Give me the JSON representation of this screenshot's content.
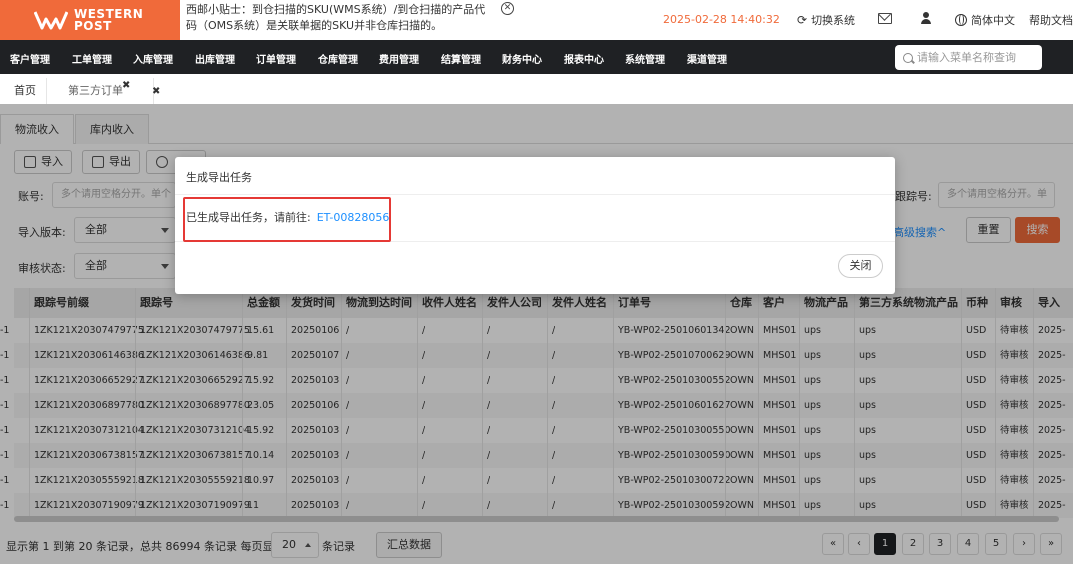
{
  "brand": {
    "name_line1": "WESTERN",
    "name_line2": "POST",
    "color": "#f06a3a"
  },
  "header": {
    "tip": "西邮小贴士：到仓扫描的SKU(WMS系统）/到仓扫描的产品代码（OMS系统）是关联单据的SKU并非仓库扫描的。",
    "datetime": "2025-02-28 14:40:32",
    "switch_system": "切换系统",
    "language": "简体中文",
    "help": "帮助文档"
  },
  "nav": {
    "items": [
      "客户管理",
      "工单管理",
      "入库管理",
      "出库管理",
      "订单管理",
      "仓库管理",
      "费用管理",
      "结算管理",
      "财务中心",
      "报表中心",
      "系统管理",
      "渠道管理"
    ],
    "search_placeholder": "请输入菜单名称查询"
  },
  "page_tabs": {
    "home": "首页",
    "current": "第三方订单"
  },
  "sub_tabs": [
    "物流收入",
    "库内收入"
  ],
  "toolbar": {
    "import": "导入",
    "export": "导出"
  },
  "filters": {
    "account_label": "账号:",
    "account_placeholder": "多个请用空格分开。单个",
    "tracking_label": "跟踪号:",
    "tracking_placeholder": "多个请用空格分开。单",
    "import_version_label": "导入版本:",
    "import_version_value": "全部",
    "review_status_label": "审核状态:",
    "review_status_value": "全部",
    "advanced": "高级搜索^",
    "reset": "重置",
    "search": "搜索"
  },
  "table": {
    "headers": [
      "跟踪号前缀",
      "跟踪号",
      "总金额",
      "发货时间",
      "物流到达时间",
      "收件人姓名",
      "发件人公司",
      "发件人姓名",
      "订单号",
      "仓库",
      "客户",
      "物流产品",
      "第三方系统物流产品",
      "币种",
      "审核",
      "导入"
    ],
    "rows": [
      [
        "-1",
        "1ZK121X20307479775",
        "1ZK121X20307479775",
        "15.61",
        "20250106",
        "/",
        "/",
        "/",
        "/",
        "YB-WP02-25010601342",
        "OWN",
        "MHS01",
        "ups",
        "ups",
        "USD",
        "待审核",
        "2025-"
      ],
      [
        "-1",
        "1ZK121X20306146386",
        "1ZK121X20306146386",
        "9.81",
        "20250107",
        "/",
        "/",
        "/",
        "/",
        "YB-WP02-25010700629",
        "OWN",
        "MHS01",
        "ups",
        "ups",
        "USD",
        "待审核",
        "2025-"
      ],
      [
        "-1",
        "1ZK121X20306652927",
        "1ZK121X20306652927",
        "15.92",
        "20250103",
        "/",
        "/",
        "/",
        "/",
        "YB-WP02-25010300552",
        "OWN",
        "MHS01",
        "ups",
        "ups",
        "USD",
        "待审核",
        "2025-"
      ],
      [
        "-1",
        "1ZK121X20306897780",
        "1ZK121X20306897780",
        "23.05",
        "20250106",
        "/",
        "/",
        "/",
        "/",
        "YB-WP02-25010601627",
        "OWN",
        "MHS01",
        "ups",
        "ups",
        "USD",
        "待审核",
        "2025-"
      ],
      [
        "-1",
        "1ZK121X20307312104",
        "1ZK121X20307312104",
        "15.92",
        "20250103",
        "/",
        "/",
        "/",
        "/",
        "YB-WP02-25010300550",
        "OWN",
        "MHS01",
        "ups",
        "ups",
        "USD",
        "待审核",
        "2025-"
      ],
      [
        "-1",
        "1ZK121X20306738157",
        "1ZK121X20306738157",
        "10.14",
        "20250103",
        "/",
        "/",
        "/",
        "/",
        "YB-WP02-25010300590",
        "OWN",
        "MHS01",
        "ups",
        "ups",
        "USD",
        "待审核",
        "2025-"
      ],
      [
        "-1",
        "1ZK121X20305559218",
        "1ZK121X20305559218",
        "10.97",
        "20250103",
        "/",
        "/",
        "/",
        "/",
        "YB-WP02-25010300722",
        "OWN",
        "MHS01",
        "ups",
        "ups",
        "USD",
        "待审核",
        "2025-"
      ],
      [
        "-1",
        "1ZK121X20307190979",
        "1ZK121X20307190979",
        "11",
        "20250103",
        "/",
        "/",
        "/",
        "/",
        "YB-WP02-25010300592",
        "OWN",
        "MHS01",
        "ups",
        "ups",
        "USD",
        "待审核",
        "2025-"
      ]
    ]
  },
  "footer": {
    "info": "显示第 1 到第 20 条记录，总共 86994 条记录 每页显示",
    "page_size": "20",
    "per_page_suffix": "条记录",
    "summary_button": "汇总数据",
    "pages": [
      "«",
      "‹",
      "1",
      "2",
      "3",
      "4",
      "5",
      "›",
      "»"
    ],
    "active_page": "1"
  },
  "modal": {
    "title": "生成导出任务",
    "message": "已生成导出任务，请前往:",
    "link": "ET-00828056",
    "close": "关闭"
  }
}
